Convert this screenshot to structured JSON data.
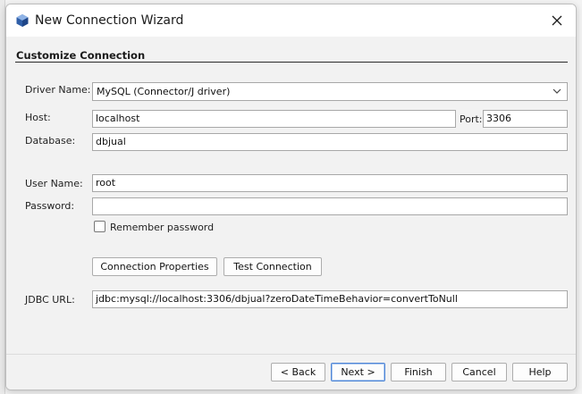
{
  "window": {
    "title": "New Connection Wizard",
    "app_icon": "netbeans-cube-icon",
    "close_icon": "close-icon"
  },
  "section": {
    "title": "Customize Connection"
  },
  "form": {
    "driver_label": "Driver Name:",
    "driver_value": "MySQL (Connector/J driver)",
    "host_label": "Host:",
    "host_value": "localhost",
    "port_label": "Port:",
    "port_value": "3306",
    "database_label": "Database:",
    "database_value": "dbjual",
    "username_label": "User Name:",
    "username_value": "root",
    "password_label": "Password:",
    "password_value": "",
    "remember_label": "Remember password",
    "remember_checked": false,
    "connection_properties_label": "Connection Properties",
    "test_connection_label": "Test Connection",
    "jdbc_label": "JDBC URL:",
    "jdbc_value": "jdbc:mysql://localhost:3306/dbjual?zeroDateTimeBehavior=convertToNull"
  },
  "footer": {
    "back_label": "< Back",
    "next_label": "Next >",
    "finish_label": "Finish",
    "cancel_label": "Cancel",
    "help_label": "Help"
  },
  "colors": {
    "dialog_bg": "#f2f2f2",
    "primary_border": "#4f86d6",
    "field_border": "#a8a8a8"
  }
}
